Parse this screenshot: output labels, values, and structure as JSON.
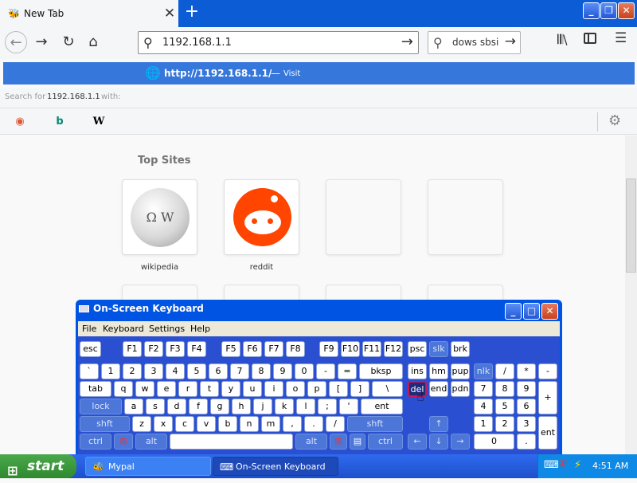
{
  "browser": {
    "tab_title": "New Tab",
    "new_tab_symbol": "+",
    "close_symbol": "✕",
    "window_buttons": {
      "minimize": "_",
      "restore": "❐",
      "close": "✕"
    },
    "url_value": "1192.168.1.1",
    "search_value": "dows sbsi",
    "suggestion": {
      "url": "http://1192.168.1.1/",
      "dash": "—",
      "action": "Visit"
    },
    "search_for": {
      "label": "Search for",
      "term": "1192.168.1.1",
      "suffix": "with:"
    },
    "engines": [
      "duckduckgo-icon",
      "bing-icon",
      "wikipedia-icon"
    ],
    "wiki_letter": "W"
  },
  "newtab": {
    "top_sites_title": "Top Sites",
    "sites": [
      {
        "label": "wikipedia",
        "icon": "wikipedia-icon"
      },
      {
        "label": "reddit",
        "icon": "reddit-icon"
      }
    ]
  },
  "osk": {
    "title": "On-Screen Keyboard",
    "menu": [
      "File",
      "Keyboard",
      "Settings",
      "Help"
    ],
    "keys": {
      "esc": "esc",
      "f1": "F1",
      "f2": "F2",
      "f3": "F3",
      "f4": "F4",
      "f5": "F5",
      "f6": "F6",
      "f7": "F7",
      "f8": "F8",
      "f9": "F9",
      "f10": "F10",
      "f11": "F11",
      "f12": "F12",
      "psc": "psc",
      "slk": "slk",
      "brk": "brk",
      "backtick": "`",
      "n1": "1",
      "n2": "2",
      "n3": "3",
      "n4": "4",
      "n5": "5",
      "n6": "6",
      "n7": "7",
      "n8": "8",
      "n9": "9",
      "n0": "0",
      "minus": "-",
      "equals": "=",
      "bksp": "bksp",
      "ins": "ins",
      "hm": "hm",
      "pup": "pup",
      "nlk": "nlk",
      "slash": "/",
      "star": "*",
      "kpminus": "-",
      "tab": "tab",
      "q": "q",
      "w": "w",
      "e": "e",
      "r": "r",
      "t": "t",
      "y": "y",
      "u": "u",
      "i": "i",
      "o": "o",
      "p": "p",
      "lbr": "[",
      "rbr": "]",
      "bslash": "\\",
      "del": "del",
      "end": "end",
      "pdn": "pdn",
      "kp7": "7",
      "kp8": "8",
      "kp9": "9",
      "kpplus": "+",
      "lock": "lock",
      "a": "a",
      "s": "s",
      "d": "d",
      "f": "f",
      "g": "g",
      "h": "h",
      "j": "j",
      "k": "k",
      "l": "l",
      "semi": ";",
      "quote": "'",
      "ent": "ent",
      "kp4": "4",
      "kp5": "5",
      "kp6": "6",
      "shft": "shft",
      "z": "z",
      "x": "x",
      "c": "c",
      "v": "v",
      "b": "b",
      "n": "n",
      "m": "m",
      "comma": ",",
      "dot": ".",
      "fslash": "/",
      "rshft": "shft",
      "up": "↑",
      "kp1": "1",
      "kp2": "2",
      "kp3": "3",
      "kpent": "ent",
      "ctrl": "ctrl",
      "alt": "alt",
      "space": "",
      "ralt": "alt",
      "rctrl": "ctrl",
      "left": "←",
      "down": "↓",
      "right": "→",
      "kp0": "0",
      "kpdot": "."
    }
  },
  "taskbar": {
    "start_label": "start",
    "tasks": [
      "Mypal",
      "On-Screen Keyboard"
    ],
    "clock": "4:51 AM"
  },
  "colors": {
    "tabbar": "#0b5cd5",
    "suggest": "#3677db",
    "osk_frame": "#0054e3",
    "taskbar": "#245edb",
    "start": "#3c9a3c"
  }
}
